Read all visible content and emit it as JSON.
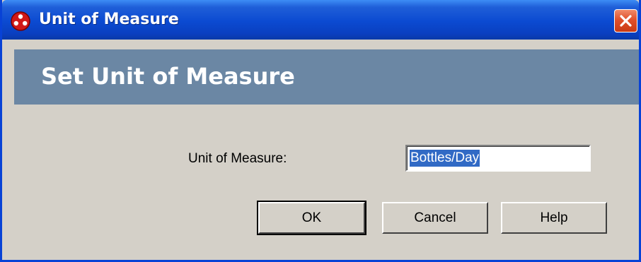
{
  "window": {
    "title": "Unit of Measure",
    "app_icon": "red-three-dot-app-icon",
    "close_icon": "close-x-icon",
    "colors": {
      "titlebar": "#0b4ad1",
      "header_band": "#6b87a4",
      "dialog_bg": "#d4d0c8",
      "close_button": "#e0502b",
      "selection": "#316ac5"
    }
  },
  "header": {
    "title": "Set Unit of Measure"
  },
  "form": {
    "unit_label": "Unit of Measure:",
    "unit_value": "Bottles/Day"
  },
  "buttons": {
    "ok_label": "OK",
    "cancel_label": "Cancel",
    "help_label": "Help"
  }
}
